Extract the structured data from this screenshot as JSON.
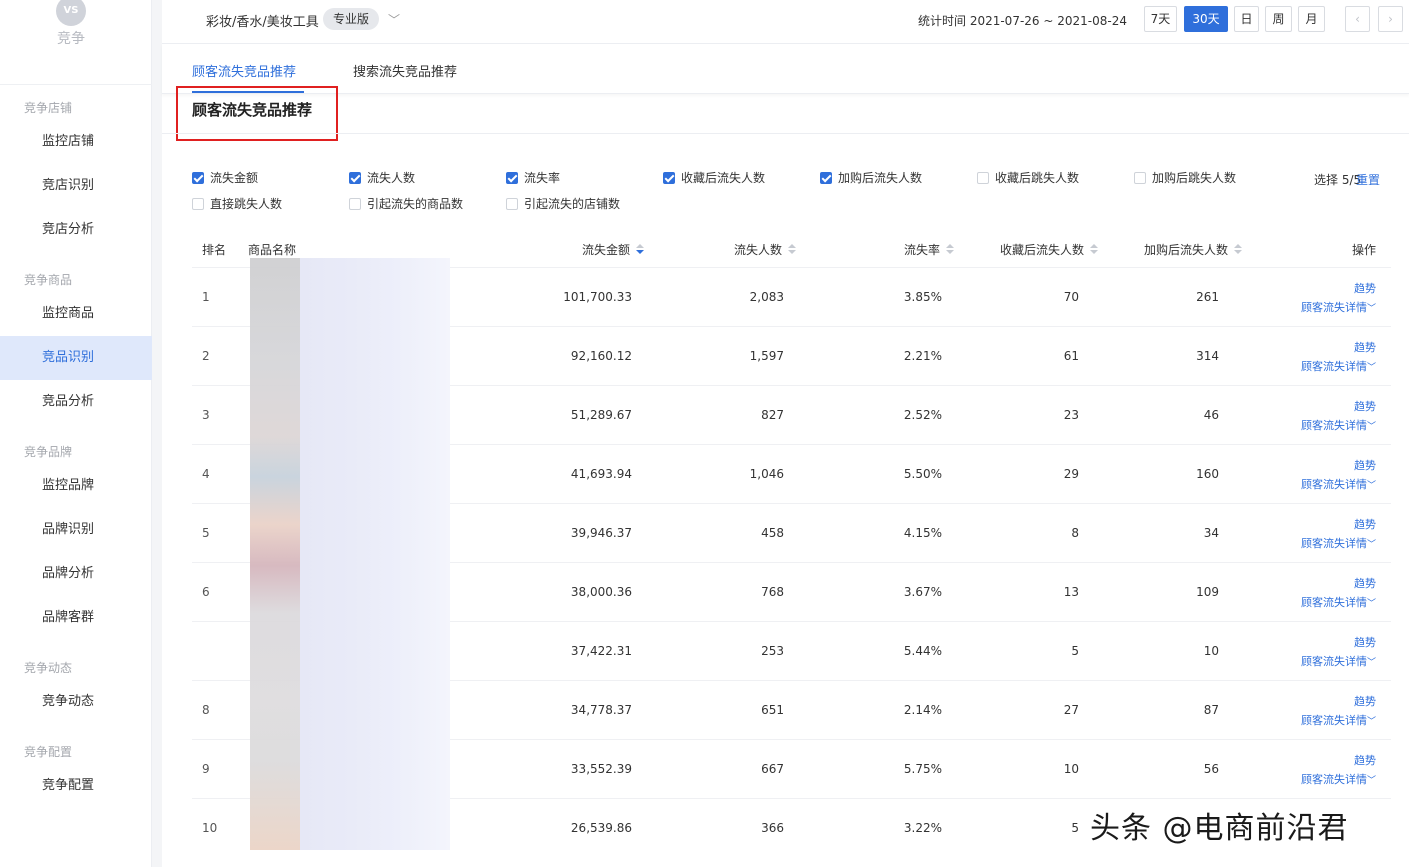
{
  "app": {
    "logo_mark": "VS",
    "logo_text": "竞争"
  },
  "sidebar": {
    "groups": [
      {
        "title": "竞争店铺",
        "items": [
          "监控店铺",
          "竞店识别",
          "竞店分析"
        ]
      },
      {
        "title": "竞争商品",
        "items": [
          "监控商品",
          "竞品识别",
          "竞品分析"
        ]
      },
      {
        "title": "竞争品牌",
        "items": [
          "监控品牌",
          "品牌识别",
          "品牌分析",
          "品牌客群"
        ]
      },
      {
        "title": "竞争动态",
        "items": [
          "竞争动态"
        ]
      },
      {
        "title": "竞争配置",
        "items": [
          "竞争配置"
        ]
      }
    ],
    "active_item": "竞品识别"
  },
  "topbar": {
    "category": "彩妆/香水/美妆工具",
    "edition": "专业版",
    "stat_time": "统计时间 2021-07-26 ~ 2021-08-24",
    "periods": [
      "7天",
      "30天",
      "日",
      "周",
      "月"
    ],
    "active_period": "30天",
    "prev_icon": "chevron-left-icon",
    "next_icon": "chevron-right-icon"
  },
  "tabs": [
    "顾客流失竞品推荐",
    "搜索流失竞品推荐"
  ],
  "section_title": "顾客流失竞品推荐",
  "filters": {
    "options": [
      {
        "label": "流失金额",
        "checked": true
      },
      {
        "label": "流失人数",
        "checked": true
      },
      {
        "label": "流失率",
        "checked": true
      },
      {
        "label": "收藏后流失人数",
        "checked": true
      },
      {
        "label": "加购后流失人数",
        "checked": true
      },
      {
        "label": "收藏后跳失人数",
        "checked": false
      },
      {
        "label": "加购后跳失人数",
        "checked": false
      },
      {
        "label": "直接跳失人数",
        "checked": false
      },
      {
        "label": "引起流失的商品数",
        "checked": false
      },
      {
        "label": "引起流失的店铺数",
        "checked": false
      }
    ],
    "select_count": "选择 5/5",
    "reset_label": "重置"
  },
  "table": {
    "headers": [
      "排名",
      "商品名称",
      "流失金额",
      "流失人数",
      "流失率",
      "收藏后流失人数",
      "加购后流失人数",
      "操作"
    ],
    "op_trend": "趋势",
    "op_detail": "顾客流失详情",
    "rows": [
      {
        "rank": "1",
        "amount": "101,700.33",
        "people": "2,083",
        "rate": "3.85%",
        "fav": "70",
        "cart": "261"
      },
      {
        "rank": "2",
        "amount": "92,160.12",
        "people": "1,597",
        "rate": "2.21%",
        "fav": "61",
        "cart": "314"
      },
      {
        "rank": "3",
        "amount": "51,289.67",
        "people": "827",
        "rate": "2.52%",
        "fav": "23",
        "cart": "46"
      },
      {
        "rank": "4",
        "amount": "41,693.94",
        "people": "1,046",
        "rate": "5.50%",
        "fav": "29",
        "cart": "160"
      },
      {
        "rank": "5",
        "amount": "39,946.37",
        "people": "458",
        "rate": "4.15%",
        "fav": "8",
        "cart": "34"
      },
      {
        "rank": "6",
        "amount": "38,000.36",
        "people": "768",
        "rate": "3.67%",
        "fav": "13",
        "cart": "109"
      },
      {
        "rank": "",
        "amount": "37,422.31",
        "people": "253",
        "rate": "5.44%",
        "fav": "5",
        "cart": "10"
      },
      {
        "rank": "8",
        "amount": "34,778.37",
        "people": "651",
        "rate": "2.14%",
        "fav": "27",
        "cart": "87"
      },
      {
        "rank": "9",
        "amount": "33,552.39",
        "people": "667",
        "rate": "5.75%",
        "fav": "10",
        "cart": "56"
      },
      {
        "rank": "10",
        "amount": "26,539.86",
        "people": "366",
        "rate": "3.22%",
        "fav": "5",
        "cart": ""
      }
    ]
  },
  "watermark": "头条 @电商前沿君",
  "colors": {
    "accent": "#2f6fdb",
    "highlight": "#e02020",
    "active_bg": "#dfe8fb"
  }
}
